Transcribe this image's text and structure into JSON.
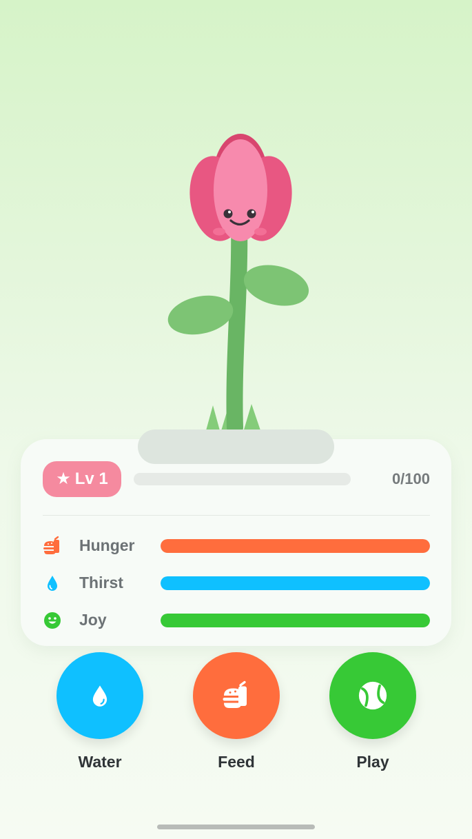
{
  "plant": {
    "character": "tulip",
    "expression": "smiling"
  },
  "level": {
    "star_glyph": "★",
    "label": "Lv 1",
    "progress_fraction": 0,
    "progress_text": "0/100"
  },
  "stats": [
    {
      "label": "Hunger",
      "icon": "burger-icon",
      "color": "#ff6d3d",
      "level_fraction": 1.0
    },
    {
      "label": "Thirst",
      "icon": "water-drop-icon",
      "color": "#0fc0ff",
      "level_fraction": 1.0
    },
    {
      "label": "Joy",
      "icon": "smiley-icon",
      "color": "#37c936",
      "level_fraction": 1.0
    }
  ],
  "actions": [
    {
      "label": "Water",
      "icon": "water-drop-icon",
      "color": "#0fc0ff"
    },
    {
      "label": "Feed",
      "icon": "burger-icon",
      "color": "#ff6d3d"
    },
    {
      "label": "Play",
      "icon": "ball-icon",
      "color": "#37c936"
    }
  ],
  "colors": {
    "accent_pink": "#f58a9f",
    "petal_dark": "#e85782",
    "petal_light": "#f78aad",
    "stem": "#69b564",
    "leaf": "#7dc474"
  }
}
